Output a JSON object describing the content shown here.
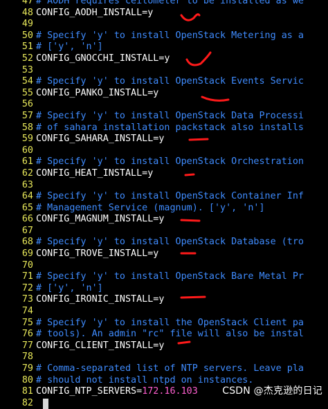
{
  "editor": {
    "lines": [
      {
        "n": "47",
        "text": "# AODH requires ceilometer to be installed as we",
        "kind": "cmt"
      },
      {
        "n": "48",
        "text": "CONFIG_AODH_INSTALL=y",
        "kind": "txt"
      },
      {
        "n": "49",
        "text": "",
        "kind": "txt"
      },
      {
        "n": "50",
        "text": "# Specify 'y' to install OpenStack Metering as a",
        "kind": "cmt"
      },
      {
        "n": "51",
        "text": "# ['y', 'n']",
        "kind": "cmt"
      },
      {
        "n": "52",
        "text": "CONFIG_GNOCCHI_INSTALL=y",
        "kind": "txt"
      },
      {
        "n": "53",
        "text": "",
        "kind": "txt"
      },
      {
        "n": "54",
        "text": "# Specify 'y' to install OpenStack Events Servic",
        "kind": "cmt"
      },
      {
        "n": "55",
        "text": "CONFIG_PANKO_INSTALL=y",
        "kind": "txt"
      },
      {
        "n": "56",
        "text": "",
        "kind": "txt"
      },
      {
        "n": "57",
        "text": "# Specify 'y' to install OpenStack Data Processi",
        "kind": "cmt"
      },
      {
        "n": "58",
        "text": "# of sahara installation packstack also installs",
        "kind": "cmt"
      },
      {
        "n": "59",
        "text": "CONFIG_SAHARA_INSTALL=y",
        "kind": "txt"
      },
      {
        "n": "60",
        "text": "",
        "kind": "txt"
      },
      {
        "n": "61",
        "text": "# Specify 'y' to install OpenStack Orchestration",
        "kind": "cmt"
      },
      {
        "n": "62",
        "text": "CONFIG_HEAT_INSTALL=y",
        "kind": "txt"
      },
      {
        "n": "63",
        "text": "",
        "kind": "txt"
      },
      {
        "n": "64",
        "text": "# Specify 'y' to install OpenStack Container Inf",
        "kind": "cmt"
      },
      {
        "n": "65",
        "text": "# Management Service (magnum). ['y', 'n']",
        "kind": "cmt"
      },
      {
        "n": "66",
        "text": "CONFIG_MAGNUM_INSTALL=y",
        "kind": "txt"
      },
      {
        "n": "67",
        "text": "",
        "kind": "txt"
      },
      {
        "n": "68",
        "text": "# Specify 'y' to install OpenStack Database (tro",
        "kind": "cmt"
      },
      {
        "n": "69",
        "text": "CONFIG_TROVE_INSTALL=y",
        "kind": "txt"
      },
      {
        "n": "70",
        "text": "",
        "kind": "txt"
      },
      {
        "n": "71",
        "text": "# Specify 'y' to install OpenStack Bare Metal Pr",
        "kind": "cmt"
      },
      {
        "n": "72",
        "text": "# ['y', 'n']",
        "kind": "cmt"
      },
      {
        "n": "73",
        "text": "CONFIG_IRONIC_INSTALL=y",
        "kind": "txt"
      },
      {
        "n": "74",
        "text": "",
        "kind": "txt"
      },
      {
        "n": "75",
        "text": "# Specify 'y' to install the OpenStack Client pa",
        "kind": "cmt"
      },
      {
        "n": "76",
        "text": "# tools). An admin \"rc\" file will also be instal",
        "kind": "cmt"
      },
      {
        "n": "77",
        "text": "CONFIG_CLIENT_INSTALL=y",
        "kind": "txt"
      },
      {
        "n": "78",
        "text": "",
        "kind": "txt"
      },
      {
        "n": "79",
        "text": "# Comma-separated list of NTP servers. Leave pla",
        "kind": "cmt"
      },
      {
        "n": "80",
        "text": "# should not install ntpd on instances.",
        "kind": "cmt"
      },
      {
        "n": "81",
        "text": "CONFIG_NTP_SERVERS=",
        "kind": "txt",
        "ip": "172.16.103"
      },
      {
        "n": "82",
        "text": "",
        "kind": "txt"
      }
    ]
  },
  "annotations": {
    "color": "#ff1a1a",
    "style": "hand-drawn underline marks"
  },
  "watermark": {
    "text": "CSDN @杰克逊的日记"
  },
  "colors": {
    "line_number": "#e8e85a",
    "comment": "#3f8cff",
    "code": "#ffffff",
    "ip": "#ff5fd0"
  }
}
